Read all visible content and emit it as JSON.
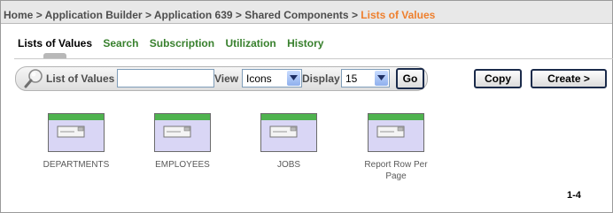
{
  "breadcrumb": {
    "items": [
      "Home",
      "Application Builder",
      "Application 639",
      "Shared Components"
    ],
    "separator": ">",
    "current": "Lists of Values"
  },
  "tabs": [
    {
      "label": "Lists of Values",
      "active": true
    },
    {
      "label": "Search",
      "active": false
    },
    {
      "label": "Subscription",
      "active": false
    },
    {
      "label": "Utilization",
      "active": false
    },
    {
      "label": "History",
      "active": false
    }
  ],
  "search": {
    "label": "List of Values",
    "value": "",
    "view_label": "View",
    "view_value": "Icons",
    "display_label": "Display",
    "display_value": "15",
    "go_label": "Go"
  },
  "actions": {
    "copy_label": "Copy",
    "create_label": "Create >"
  },
  "items": [
    {
      "label": "DEPARTMENTS"
    },
    {
      "label": "EMPLOYEES"
    },
    {
      "label": "JOBS"
    },
    {
      "label": "Report Row Per Page"
    }
  ],
  "pagination": "1-4",
  "colors": {
    "tab_active": "#000000",
    "tab_link": "#38802d",
    "breadcrumb_current": "#ee7f2d",
    "icon_header": "#4fb34f",
    "icon_body": "#d9d6f5"
  }
}
